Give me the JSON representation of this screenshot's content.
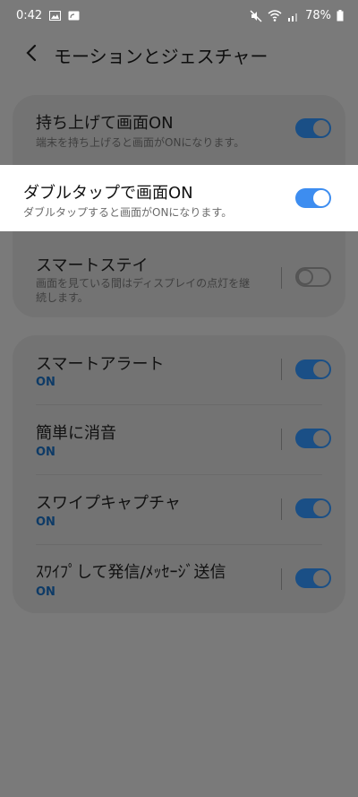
{
  "status": {
    "time": "0:42",
    "battery": "78%"
  },
  "header": {
    "title": "モーションとジェスチャー"
  },
  "card1": {
    "items": [
      {
        "title": "持ち上げて画面ON",
        "subtitle": "端末を持ち上げると画面がONになります。",
        "enabled": true
      },
      {
        "title": "ダブルタップで画面ON",
        "subtitle": "ダブルタップすると画面がONになります。",
        "enabled": true
      },
      {
        "title": "スマートステイ",
        "subtitle_line1": "画面を見ている間はディスプレイの点灯を継",
        "subtitle_line2": "続します。",
        "enabled": false
      }
    ]
  },
  "card2": {
    "items": [
      {
        "title": "スマートアラート",
        "state": "ON",
        "enabled": true
      },
      {
        "title": "簡単に消音",
        "state": "ON",
        "enabled": true
      },
      {
        "title": "スワイプキャプチャ",
        "state": "ON",
        "enabled": true
      },
      {
        "title": "ｽﾜｲﾌﾟして発信/ﾒｯｾｰｼﾞ送信",
        "state": "ON",
        "enabled": true
      }
    ]
  },
  "colors": {
    "toggle_on": "#3d8df0",
    "highlight_bg": "#ffffff",
    "dim_bg": "#7a7a7a"
  },
  "icons": {
    "back": "chevron-left-icon",
    "status": [
      "image-icon",
      "cast-icon",
      "mute-icon",
      "wifi-icon",
      "signal-icon",
      "battery-icon"
    ]
  }
}
